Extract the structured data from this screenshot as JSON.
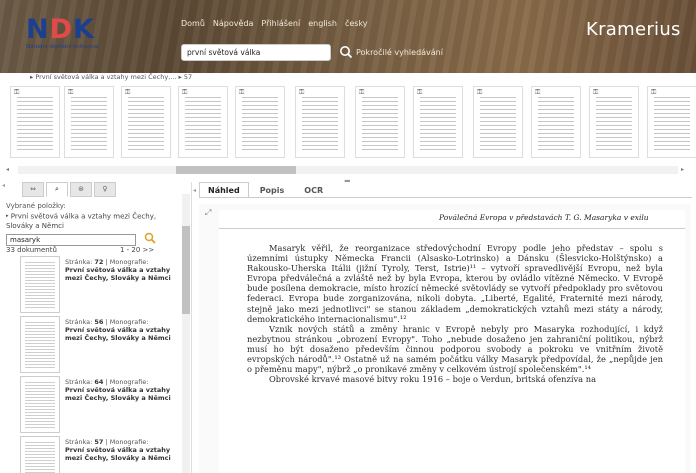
{
  "header": {
    "logo": "NDK",
    "logo_sub": "Národní digitální knihovna",
    "nav": [
      "Domů",
      "Nápověda",
      "Přihlášení",
      "english",
      "česky"
    ],
    "search_value": "první světová válka",
    "advanced_search": "Pokročilé vyhledávání",
    "app_name": "Kramerius"
  },
  "breadcrumb": "▸ První světová válka a vztahy mezi Čechy,... ▸ 57",
  "left": {
    "tabs": [
      "⇔",
      "⌕",
      "⊛",
      "♀"
    ],
    "selected_label": "Vybrané položky:",
    "selected_item": "První světová válka a vztahy mezi Čechy, Slováky a Němci",
    "search_value": "masaryk",
    "result_count": "33 dokumentů",
    "result_range": "1 - 20  >>",
    "results": [
      {
        "page_label": "Stránka:",
        "page": "72",
        "type": "| Monografie:",
        "title": "První světová válka a vztahy mezi Čechy, Slováky a Němci"
      },
      {
        "page_label": "Stránka:",
        "page": "56",
        "type": "| Monografie:",
        "title": "První světová válka a vztahy mezi Čechy, Slováky a Němci"
      },
      {
        "page_label": "Stránka:",
        "page": "64",
        "type": "| Monografie:",
        "title": "První světová válka a vztahy mezi Čechy, Slováky a Němci"
      },
      {
        "page_label": "Stránka:",
        "page": "57",
        "type": "| Monografie:",
        "title": "První světová válka a vztahy mezi Čechy, Slováky a Němci"
      }
    ]
  },
  "right": {
    "tabs": [
      "Náhled",
      "Popis",
      "OCR"
    ],
    "toolbar": [
      "⤢",
      "+",
      "−",
      "←",
      "→",
      "⌕"
    ],
    "running_head": "Poválečná Evropa v představách T. G. Masaryka v exilu",
    "paragraphs": [
      "Masaryk věřil, že reorganizace středovýchodní Evropy podle jeho představ – spolu s územními ústupky Německa Francii (Alsasko-Lotrinsko) a Dánsku (Šlesvicko-Holštýnsko) a Rakousko-Uherska Itálii (jižní Tyroly, Terst, Istrie)¹¹ – vytvoří spravedlivější Evropu, než byla Evropa předválečná a zvláště než by byla Evropa, kterou by ovládlo vítězné Německo. V Evropě bude posílena demokracie, místo hrozící německé světovlády se vytvoří předpoklady pro světovou federaci. Evropa bude zorganizována, nikoli dobyta. „Liberté, Egalité, Fraternité mezi národy, stejně jako mezi jednotlivci\" se stanou základem „demokratických vztahů mezi státy a národy, demokratického internacionalismu\".¹²",
      "Vznik nových států a změny hranic v Evropě nebyly pro Masaryka rozhodující, i když nezbytnou stránkou „obrození Evropy\". Toho „nebude dosaženo jen zahraniční politikou, nýbrž musí ho být dosaženo především činnou podporou svobody a pokroku ve vnitřním životě evropských národů\".¹³ Ostatně už na samém počátku války Masaryk předpovídal, že „nepůjde jen o přeměnu mapy\", nýbrž „o pronikavé změny v celkovém ústrojí společenském\".¹⁴",
      "Obrovské krvavé masové bitvy roku 1916 – boje o Verdun, britská ofenzíva na"
    ]
  }
}
